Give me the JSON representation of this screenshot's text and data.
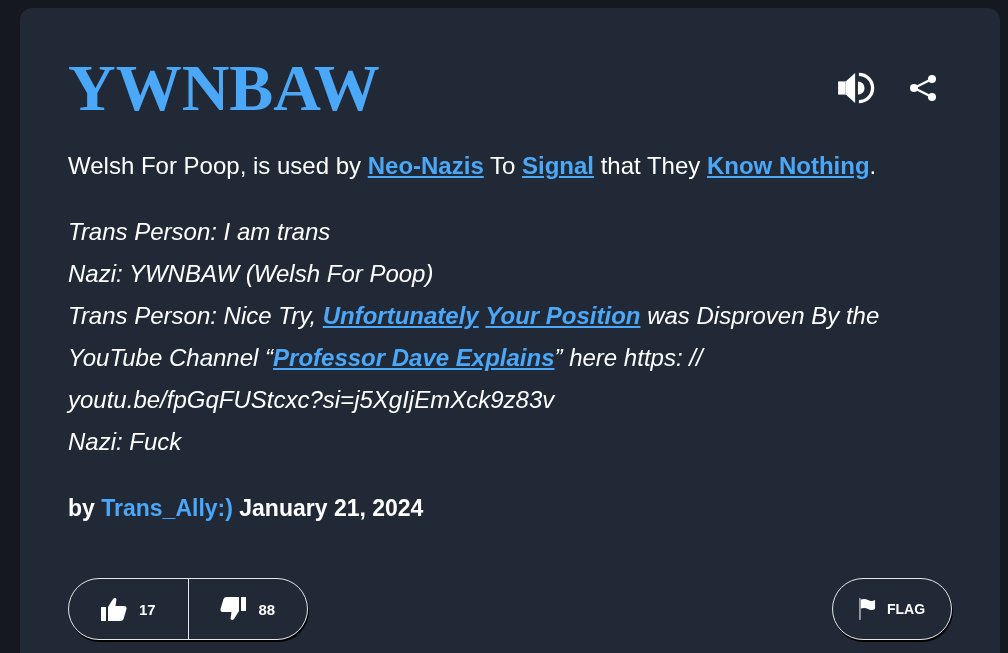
{
  "entry": {
    "word": "YWNBAW",
    "meaning": [
      {
        "kind": "text",
        "text": "Welsh For Poop, is used by "
      },
      {
        "kind": "link",
        "text": "Neo-Nazis"
      },
      {
        "kind": "text",
        "text": " To "
      },
      {
        "kind": "link",
        "text": "Signal"
      },
      {
        "kind": "text",
        "text": " that They "
      },
      {
        "kind": "link",
        "text": "Know Nothing"
      },
      {
        "kind": "text",
        "text": "."
      }
    ],
    "example": [
      [
        {
          "kind": "text",
          "text": "Trans Person: I am trans"
        }
      ],
      [
        {
          "kind": "text",
          "text": "Nazi: YWNBAW (Welsh For Poop)"
        }
      ],
      [
        {
          "kind": "text",
          "text": "Trans Person: Nice Try, "
        },
        {
          "kind": "link",
          "text": "Unfortunately "
        },
        {
          "kind": "link",
          "text": "Your Position"
        },
        {
          "kind": "text",
          "text": " was Disproven By the YouTube Channel “"
        },
        {
          "kind": "link",
          "text": "Professor Dave Explains"
        },
        {
          "kind": "text",
          "text": "” here https: // youtu.be/fpGqFUStcxc?si=j5XgIjEmXck9z83v"
        }
      ],
      [
        {
          "kind": "text",
          "text": "Nazi: Fuck"
        }
      ]
    ],
    "contributor": [
      {
        "kind": "text",
        "text": "by "
      },
      {
        "kind": "author",
        "text": "Trans_Ally:)"
      },
      {
        "kind": "text",
        "text": " January 21, 2024"
      }
    ],
    "votes": [
      {
        "kind": "up",
        "count": "17"
      },
      {
        "kind": "down",
        "count": "88"
      }
    ],
    "flag": {
      "label": "FLAG"
    }
  }
}
